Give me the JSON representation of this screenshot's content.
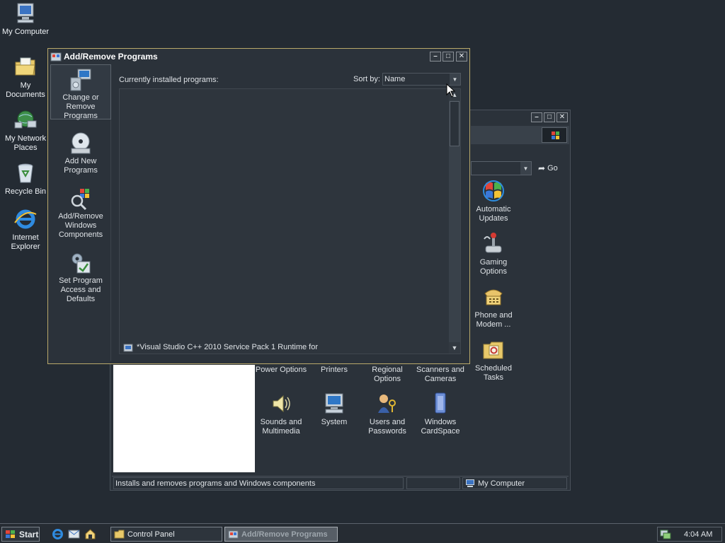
{
  "desktop": {
    "icons": [
      {
        "label": "My Computer",
        "icon": "computer-icon"
      },
      {
        "label": "My Documents",
        "icon": "folder-documents-icon"
      },
      {
        "label": "My Network Places",
        "icon": "network-icon"
      },
      {
        "label": "Recycle Bin",
        "icon": "recycle-bin-icon"
      },
      {
        "label": "Internet Explorer",
        "icon": "ie-icon"
      }
    ]
  },
  "arp": {
    "title": "Add/Remove Programs",
    "sidebar": [
      {
        "label": "Change or Remove Programs",
        "icon": "change-remove-programs-icon",
        "selected": true
      },
      {
        "label": "Add New Programs",
        "icon": "cd-install-icon",
        "selected": false
      },
      {
        "label": "Add/Remove Windows Components",
        "icon": "windows-components-icon",
        "selected": false
      },
      {
        "label": "Set Program Access and Defaults",
        "icon": "program-defaults-icon",
        "selected": false
      }
    ],
    "installed_label": "Currently installed programs:",
    "sort_by_label": "Sort by:",
    "sort_by_value": "Name",
    "program_item": "*Visual Studio C++ 2010 Service Pack 1 Runtime for"
  },
  "control_panel": {
    "go_label": "Go",
    "icons_right": [
      {
        "label": "Automatic Updates",
        "icon": "automatic-updates-icon"
      },
      {
        "label": "Gaming Options",
        "icon": "gaming-options-icon"
      },
      {
        "label": "Phone and Modem ...",
        "icon": "phone-modem-icon"
      },
      {
        "label": "Scheduled Tasks",
        "icon": "scheduled-tasks-icon"
      }
    ],
    "icons_row_labels": [
      {
        "label": "Power Options"
      },
      {
        "label": "Printers"
      },
      {
        "label": "Regional Options"
      },
      {
        "label": "Scanners and Cameras"
      }
    ],
    "icons_bottom": [
      {
        "label": "Sounds and Multimedia",
        "icon": "speaker-icon"
      },
      {
        "label": "System",
        "icon": "system-icon"
      },
      {
        "label": "Users and Passwords",
        "icon": "users-passwords-icon"
      },
      {
        "label": "Windows CardSpace",
        "icon": "cardspace-icon"
      }
    ],
    "status_text": "Installs and removes programs and Windows components",
    "status_zone": "My Computer"
  },
  "taskbar": {
    "start_label": "Start",
    "tasks": [
      {
        "label": "Control Panel",
        "active": false
      },
      {
        "label": "Add/Remove Programs",
        "active": true
      }
    ],
    "clock": "4:04 AM"
  },
  "colors": {
    "desktop_bg": "#242b33",
    "window_bg": "#2b323a",
    "accent_border": "#b8a86a"
  }
}
